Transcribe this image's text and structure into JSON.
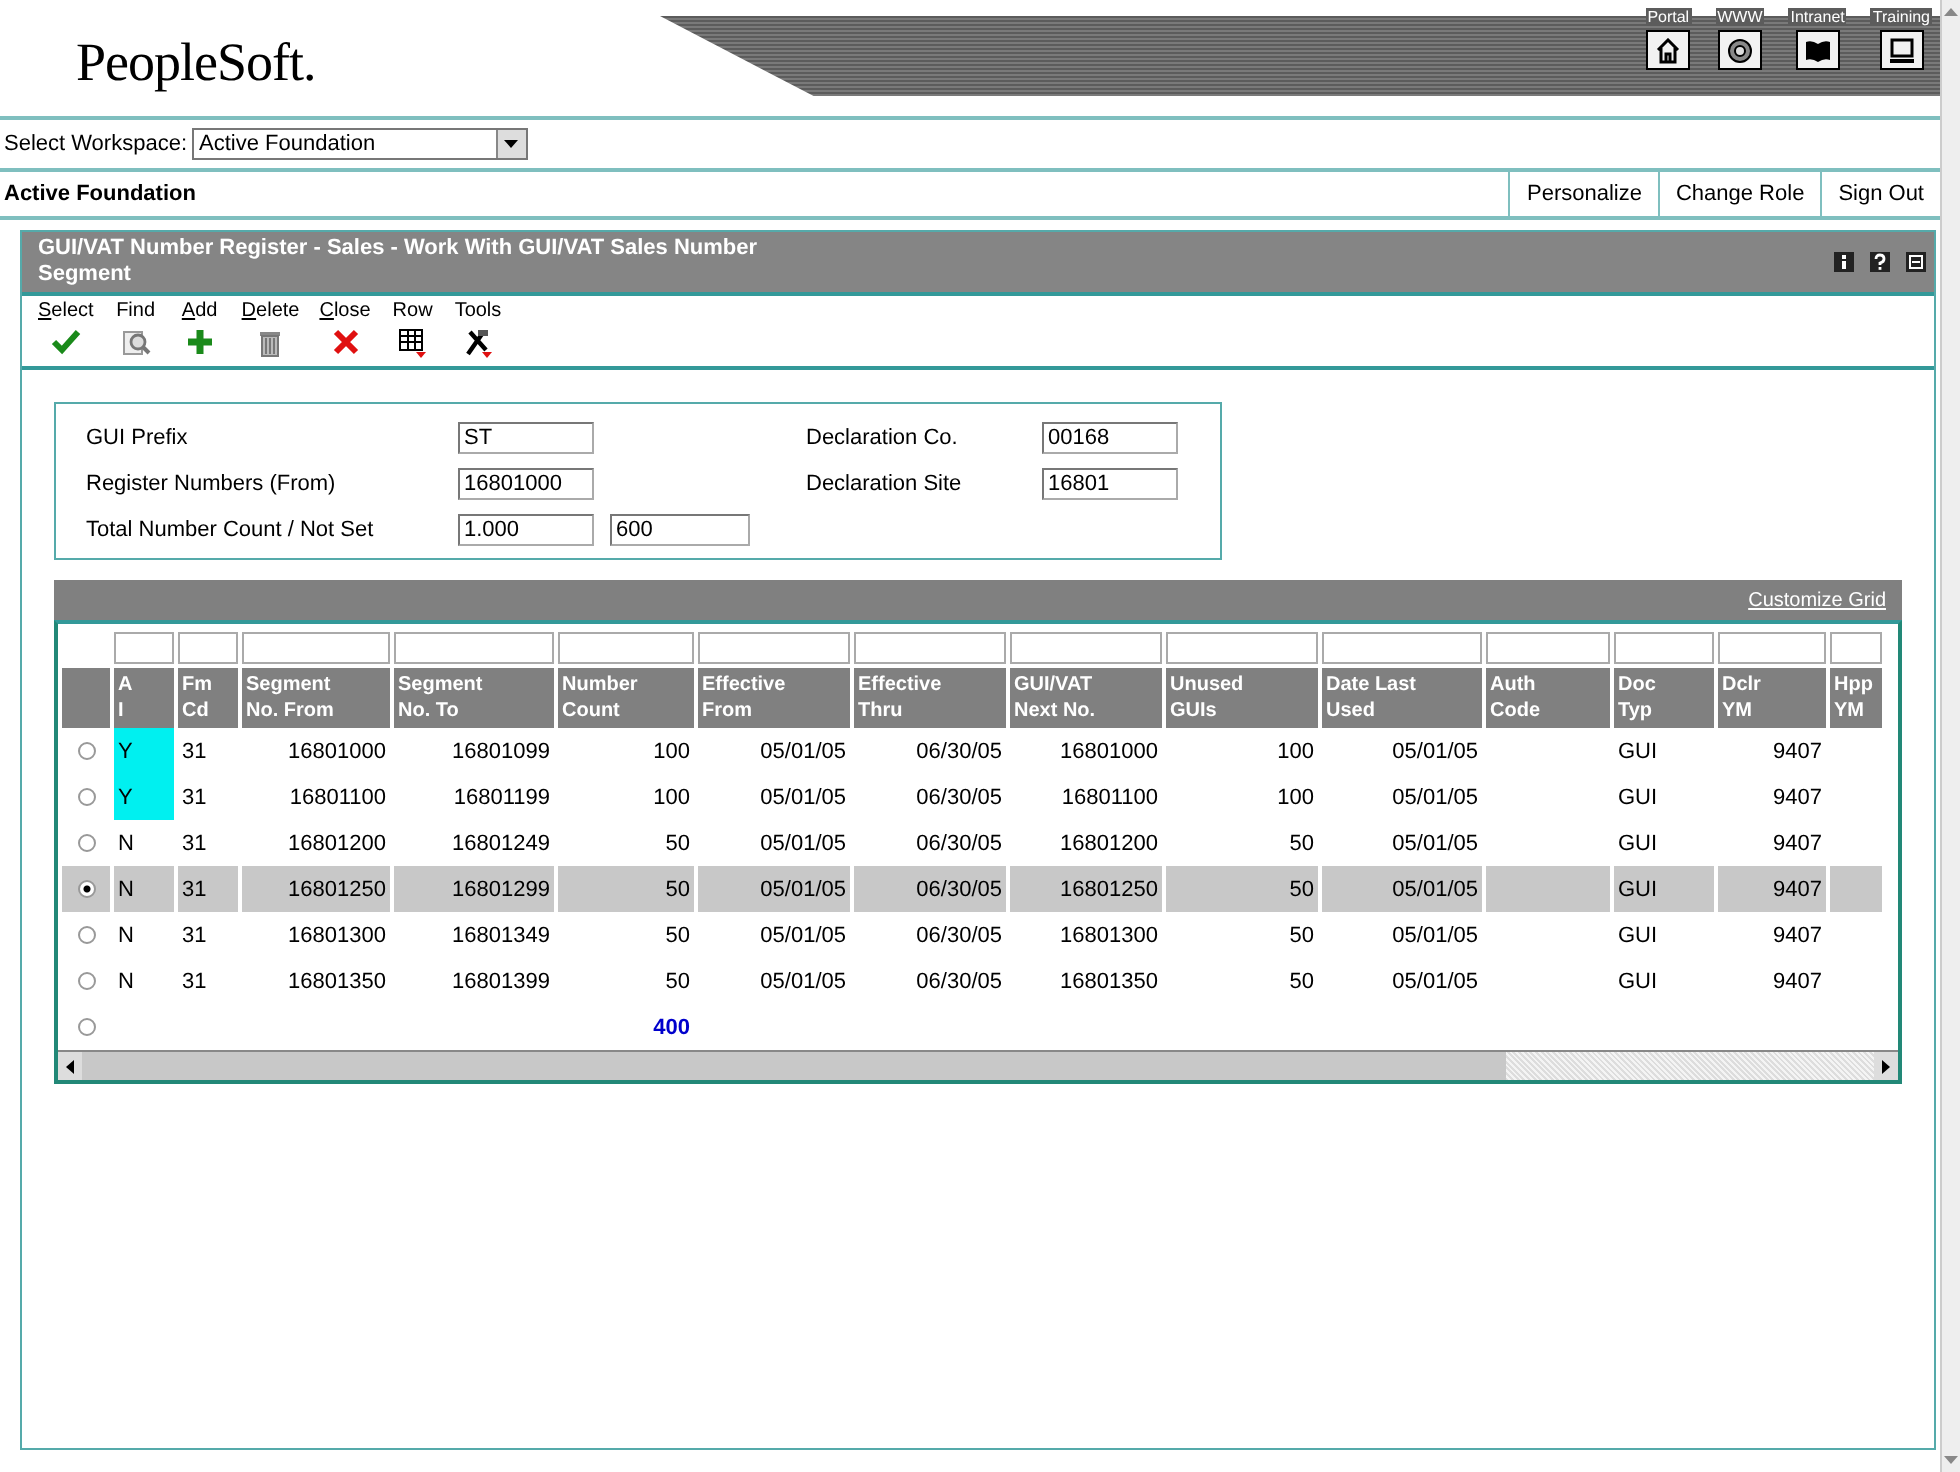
{
  "header": {
    "logo": "PeopleSoft.",
    "nav": [
      {
        "label": "Portal",
        "kind": "home"
      },
      {
        "label": "WWW",
        "kind": "globe"
      },
      {
        "label": "Intranet",
        "kind": "book"
      },
      {
        "label": "Training",
        "kind": "monitor"
      }
    ]
  },
  "workspace": {
    "label": "Select Workspace:",
    "value": "Active Foundation"
  },
  "role_bar": {
    "title": "Active Foundation",
    "links": [
      "Personalize",
      "Change Role",
      "Sign Out"
    ]
  },
  "form": {
    "title": "GUI/VAT Number Register - Sales - Work With GUI/VAT Sales Number Segment",
    "toolbar": [
      {
        "label": "Select",
        "underline_first": true,
        "kind": "check"
      },
      {
        "label": "Find",
        "underline_first": false,
        "kind": "find"
      },
      {
        "label": "Add",
        "underline_first": true,
        "kind": "plus"
      },
      {
        "label": "Delete",
        "underline_first": true,
        "kind": "trash"
      },
      {
        "label": "Close",
        "underline_first": true,
        "kind": "close"
      },
      {
        "label": "Row",
        "underline_first": false,
        "kind": "grid"
      },
      {
        "label": "Tools",
        "underline_first": false,
        "kind": "tools"
      }
    ],
    "fields_left": [
      {
        "label": "GUI Prefix",
        "values": [
          "ST"
        ]
      },
      {
        "label": "Register Numbers (From)",
        "values": [
          "16801000"
        ]
      },
      {
        "label": "Total Number Count / Not Set",
        "values": [
          "1.000",
          "600"
        ]
      }
    ],
    "fields_right": [
      {
        "label": "Declaration Co.",
        "values": [
          "00168"
        ]
      },
      {
        "label": "Declaration Site",
        "values": [
          "16801"
        ]
      }
    ],
    "grid": {
      "link": "Customize Grid",
      "columns": [
        {
          "lines": [
            "A",
            "I"
          ],
          "kind": "text"
        },
        {
          "lines": [
            "Fm",
            "Cd"
          ],
          "kind": "text"
        },
        {
          "lines": [
            "Segment",
            "No. From"
          ],
          "kind": "number"
        },
        {
          "lines": [
            "Segment",
            "No. To"
          ],
          "kind": "number"
        },
        {
          "lines": [
            "Number",
            "Count"
          ],
          "kind": "number"
        },
        {
          "lines": [
            "Effective",
            "From"
          ],
          "kind": "number"
        },
        {
          "lines": [
            "Effective",
            "Thru"
          ],
          "kind": "number"
        },
        {
          "lines": [
            "GUI/VAT",
            "Next No."
          ],
          "kind": "number"
        },
        {
          "lines": [
            "Unused",
            "GUIs"
          ],
          "kind": "number"
        },
        {
          "lines": [
            "Date Last",
            "Used"
          ],
          "kind": "number"
        },
        {
          "lines": [
            "Auth",
            "Code"
          ],
          "kind": "text"
        },
        {
          "lines": [
            "Doc",
            "Typ"
          ],
          "kind": "text"
        },
        {
          "lines": [
            "Dclr",
            "YM"
          ],
          "kind": "number"
        },
        {
          "lines": [
            "Hpp",
            "YM"
          ],
          "kind": "text"
        }
      ],
      "rows": [
        {
          "kind": "data",
          "selected": false,
          "flag_highlight": true,
          "cells": [
            "Y",
            "31",
            "16801000",
            "16801099",
            "100",
            "05/01/05",
            "06/30/05",
            "16801000",
            "100",
            "05/01/05",
            "",
            "GUI",
            "9407",
            ""
          ]
        },
        {
          "kind": "data",
          "selected": false,
          "flag_highlight": true,
          "cells": [
            "Y",
            "31",
            "16801100",
            "16801199",
            "100",
            "05/01/05",
            "06/30/05",
            "16801100",
            "100",
            "05/01/05",
            "",
            "GUI",
            "9407",
            ""
          ]
        },
        {
          "kind": "data",
          "selected": false,
          "flag_highlight": false,
          "cells": [
            "N",
            "31",
            "16801200",
            "16801249",
            "50",
            "05/01/05",
            "06/30/05",
            "16801200",
            "50",
            "05/01/05",
            "",
            "GUI",
            "9407",
            ""
          ]
        },
        {
          "kind": "data",
          "selected": true,
          "flag_highlight": false,
          "cells": [
            "N",
            "31",
            "16801250",
            "16801299",
            "50",
            "05/01/05",
            "06/30/05",
            "16801250",
            "50",
            "05/01/05",
            "",
            "GUI",
            "9407",
            ""
          ]
        },
        {
          "kind": "data",
          "selected": false,
          "flag_highlight": false,
          "cells": [
            "N",
            "31",
            "16801300",
            "16801349",
            "50",
            "05/01/05",
            "06/30/05",
            "16801300",
            "50",
            "05/01/05",
            "",
            "GUI",
            "9407",
            ""
          ]
        },
        {
          "kind": "data",
          "selected": false,
          "flag_highlight": false,
          "cells": [
            "N",
            "31",
            "16801350",
            "16801399",
            "50",
            "05/01/05",
            "06/30/05",
            "16801350",
            "50",
            "05/01/05",
            "",
            "GUI",
            "9407",
            ""
          ]
        },
        {
          "kind": "total",
          "selected": false,
          "number_count": "400"
        }
      ]
    }
  }
}
